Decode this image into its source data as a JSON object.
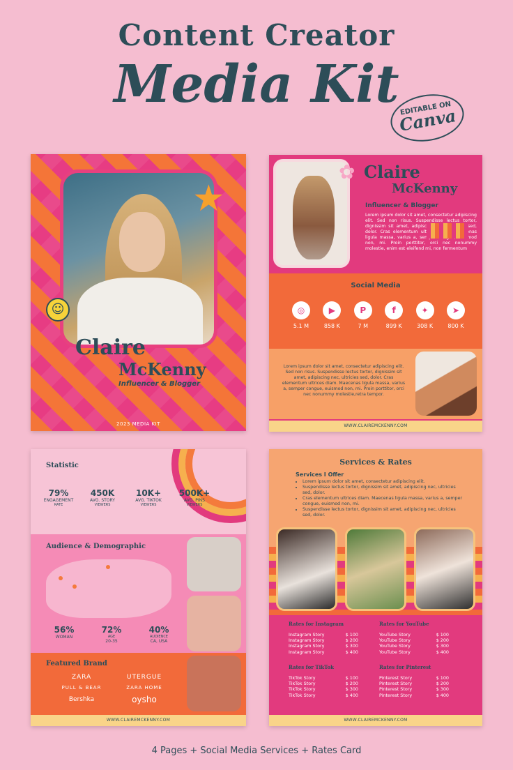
{
  "header": {
    "line1": "Content Creator",
    "line2": "Media Kit",
    "badge_top": "EDITABLE ON",
    "badge_brand": "Canva"
  },
  "page1": {
    "first": "Claire",
    "last": "McKenny",
    "role": "Influencer & Blogger",
    "kit": "2023 MEDIA KIT"
  },
  "page2": {
    "first": "Claire",
    "last": "McKenny",
    "role": "Influencer & Blogger",
    "bio": "Lorem ipsum dolor sit amet, consectetur adipiscing elit. Sed non risus. Suspendisse lectus tortor, dignissim sit amet, adipiscing nec, ultricies sed, dolor. Cras elementum ultrices diam. Maecenas ligula massa, varius a, semper congue, euismod non, mi. Proin porttitor, orci nec nonummy molestie, enim est eleifend mi, non fermentum",
    "social_title": "Social Media",
    "social": [
      {
        "icon": "instagram-icon",
        "glyph": "◎",
        "count": "5.1 M"
      },
      {
        "icon": "youtube-icon",
        "glyph": "▶",
        "count": "858 K"
      },
      {
        "icon": "pinterest-icon",
        "glyph": "P",
        "count": "7 M"
      },
      {
        "icon": "facebook-icon",
        "glyph": "f",
        "count": "899 K"
      },
      {
        "icon": "twitter-icon",
        "glyph": "✦",
        "count": "308 K"
      },
      {
        "icon": "telegram-icon",
        "glyph": "➤",
        "count": "800 K"
      }
    ],
    "text2": "Lorem ipsum dolor sit amet, consectetur adipiscing elit. Sed non risus. Suspendisse lectus tortor, dignissim sit amet, adipiscing nec, ultricies sed, dolor. Cras elementum ultrices diam. Maecenas ligula massa, varius a, semper congue, euismod non, mi. Proin porttitor, orci nec nonummy molestie,retra tempor.",
    "footer": "WWW.CLAIREMCKENNY.COM"
  },
  "page3": {
    "statistic_title": "Statistic",
    "stats": [
      {
        "v": "79%",
        "l": "ENGAGEMENT",
        "l2": "RATE"
      },
      {
        "v": "450K",
        "l": "AVG. STORY",
        "l2": "VIEWERS"
      },
      {
        "v": "10K+",
        "l": "AVG. TIKTOK",
        "l2": "VIEWERS"
      },
      {
        "v": "500K+",
        "l": "AVG. PINS",
        "l2": "VIEWERS"
      }
    ],
    "audience_title": "Audience & Demographic",
    "demo": [
      {
        "v": "56%",
        "l": "WOMAN",
        "l2": ""
      },
      {
        "v": "72%",
        "l": "AGE",
        "l2": "20-35"
      },
      {
        "v": "40%",
        "l": "AUDIENCE",
        "l2": "CA, USA"
      }
    ],
    "brand_title": "Featured Brand",
    "brands": [
      "ZARA",
      "UTERGUE",
      "PULL & BEAR",
      "ZARA HOME",
      "Bershka",
      "oysho"
    ],
    "footer": "WWW.CLAIREMCKENNY.COM"
  },
  "page4": {
    "title": "Services & Rates",
    "sub": "Services I Offer",
    "services": [
      "Lorem ipsum dolor sit amet, consectetur adipiscing elit.",
      "Suspendisse lectus tortor, dignissim sit amet, adipiscing nec, ultricies sed, dolor.",
      "Cras elementum ultrices diam. Maecenas ligula massa, varius a, semper congue, euismod non, mi.",
      "Suspendisse lectus tortor, dignissim sit amet, adipiscing nec, ultricies sed, dolor."
    ],
    "rates": [
      {
        "title": "Rates for Instagram",
        "rows": [
          [
            "Instagram Story",
            "$ 100"
          ],
          [
            "Instagram Story",
            "$ 200"
          ],
          [
            "Instagram Story",
            "$ 300"
          ],
          [
            "Instagram Story",
            "$ 400"
          ]
        ]
      },
      {
        "title": "Rates for YouTube",
        "rows": [
          [
            "YouTube Story",
            "$ 100"
          ],
          [
            "YouTube Story",
            "$ 200"
          ],
          [
            "YouTube Story",
            "$ 300"
          ],
          [
            "YouTube Story",
            "$ 400"
          ]
        ]
      },
      {
        "title": "Rates for TikTok",
        "rows": [
          [
            "TikTok Story",
            "$ 100"
          ],
          [
            "TikTok Story",
            "$ 200"
          ],
          [
            "TikTok Story",
            "$ 300"
          ],
          [
            "TikTok Story",
            "$ 400"
          ]
        ]
      },
      {
        "title": "Rates for Pinterest",
        "rows": [
          [
            "Pinterest Story",
            "$ 100"
          ],
          [
            "Pinterest Story",
            "$ 200"
          ],
          [
            "Pinterest Story",
            "$ 300"
          ],
          [
            "Pinterest Story",
            "$ 400"
          ]
        ]
      }
    ],
    "footer": "WWW.CLAIREMCKENNY.COM"
  },
  "caption": "4 Pages + Social Media Services + Rates Card"
}
